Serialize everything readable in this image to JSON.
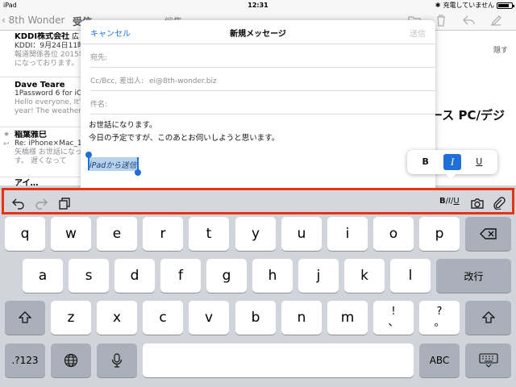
{
  "status_bar": {
    "device": "iPad",
    "time": "12:31",
    "charging_label": "充電していません"
  },
  "mail_app": {
    "back_label": "8th Wonder",
    "mailbox_title": "受信",
    "edit_label": "編集",
    "detail_hide": "隠す",
    "detail_subject_fragment": "ース PC/デジ",
    "messages": [
      {
        "sender": "KDDI株式会社",
        "sender_suffix": "広",
        "line2": "KDDI：9月24日11時",
        "line3": "報道関係各位 2015年",
        "line4": "になっております。"
      },
      {
        "sender": "Dave Teare",
        "line2": "1Password 6 for iOS",
        "line3": "Hello everyone, It's",
        "line4": "year! The weather i"
      },
      {
        "sender": "稲葉雅巳",
        "line2": "Re: iPhone×Mac_15",
        "line3": "矢橋様 お世話になっ",
        "line4": "す。 遅くなって"
      },
      {
        "sender": "アイ…",
        "line2": "",
        "line3": "",
        "line4": ""
      }
    ]
  },
  "compose": {
    "cancel_label": "キャンセル",
    "title": "新規メッセージ",
    "send_label": "送信",
    "to_label": "宛先:",
    "cc_label": "Cc/Bcc, 差出人:",
    "cc_value": "ei@8th-wonder.biz",
    "subject_label": "件名:",
    "body_line1": "お世話になります。",
    "body_line2": "今日の予定ですが、このあとお伺いしようと思います。",
    "selected_text": "iPadから送信"
  },
  "format_popover": {
    "bold": "B",
    "italic": "I",
    "underline": "U"
  },
  "shortcut_bar": {
    "biu_b": "B",
    "biu_i": "I",
    "biu_u": "U"
  },
  "keyboard": {
    "row1": [
      "q",
      "w",
      "e",
      "r",
      "t",
      "y",
      "u",
      "i",
      "o",
      "p"
    ],
    "row2": [
      "a",
      "s",
      "d",
      "f",
      "g",
      "h",
      "j",
      "k",
      "l"
    ],
    "return_label": "改行",
    "row3": [
      "z",
      "x",
      "c",
      "v",
      "b",
      "n",
      "m"
    ],
    "punct1_top": "!",
    "punct1_bottom": "、",
    "punct2_top": "?",
    "punct2_bottom": "。",
    "numbers_label": ".?123",
    "abc_label": "ABC"
  },
  "colors": {
    "accent": "#1a73e8",
    "highlight_border": "#e63312",
    "selection": "#b7d2ef"
  }
}
